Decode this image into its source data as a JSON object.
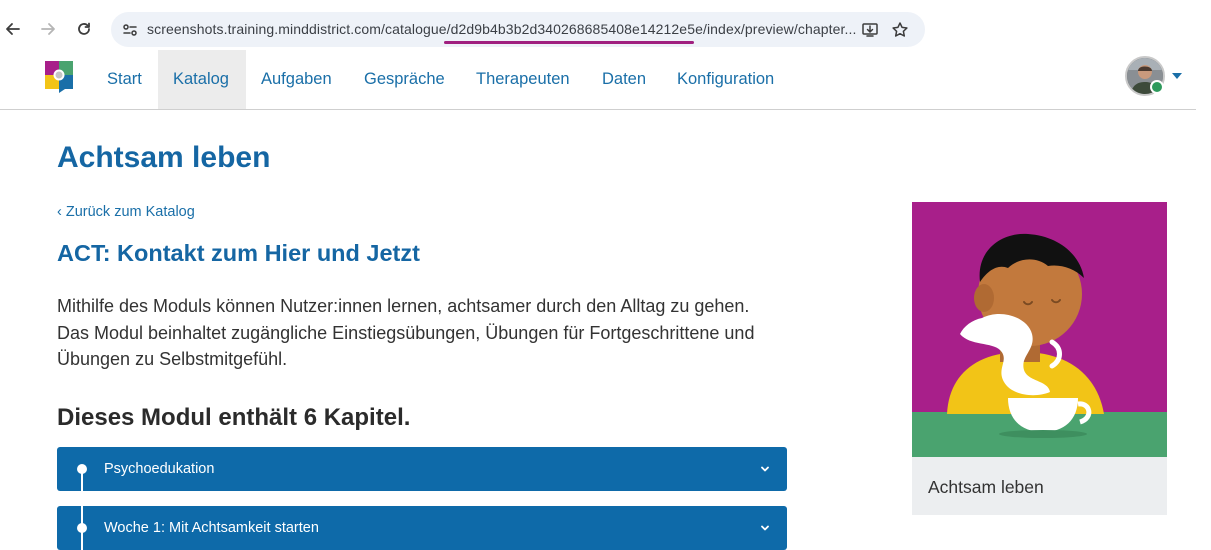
{
  "browser": {
    "url_prefix": "screenshots.training.minddistrict.com/catalogue/",
    "url_highlight": "d2d9b4b3b2d340268685408e14212e5e",
    "url_suffix": "/index/preview/chapter..."
  },
  "nav": {
    "items": [
      {
        "label": "Start"
      },
      {
        "label": "Katalog",
        "active": true
      },
      {
        "label": "Aufgaben"
      },
      {
        "label": "Gespräche"
      },
      {
        "label": "Therapeuten"
      },
      {
        "label": "Daten"
      },
      {
        "label": "Konfiguration"
      }
    ]
  },
  "page": {
    "title": "Achtsam leben",
    "back_link": "‹ Zurück zum Katalog",
    "module_title": "ACT: Kontakt zum Hier und Jetzt",
    "module_description": "Mithilfe des Moduls können Nutzer:innen lernen, achtsamer durch den Alltag zu gehen. Das Modul beinhaltet zugängliche Einstiegsübungen, Übungen für Fortgeschrittene und Übungen zu Selbstmitgefühl.",
    "chapters_heading": "Dieses Modul enthält 6 Kapitel.",
    "chapters": [
      {
        "label": "Psychoedukation"
      },
      {
        "label": "Woche 1: Mit Achtsamkeit starten"
      }
    ]
  },
  "card": {
    "label": "Achtsam leben"
  },
  "colors": {
    "primary": "#1566a3",
    "chapter_bg": "#0e6aa9",
    "card_magenta": "#a81f8a",
    "card_green": "#4aa36f",
    "card_yellow": "#f2c417"
  }
}
